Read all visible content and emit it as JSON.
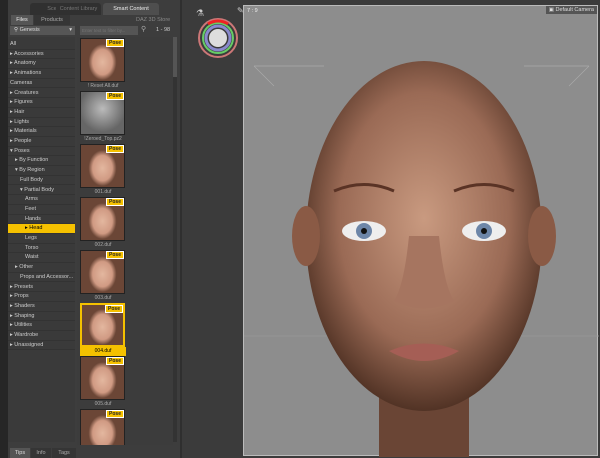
{
  "tabs": [
    "Scene",
    "Content Library",
    "Smart Content"
  ],
  "subtabs": [
    "Files",
    "Products"
  ],
  "store_label": "DAZ 3D Store",
  "figure_dropdown": "Genesis",
  "filter_placeholder": "Enter text to filter by...",
  "result_range": "1 - 98",
  "tree": [
    {
      "label": "All",
      "level": 0,
      "arrow": ""
    },
    {
      "label": "Accessories",
      "level": 0,
      "arrow": "▸"
    },
    {
      "label": "Anatomy",
      "level": 0,
      "arrow": "▸"
    },
    {
      "label": "Animations",
      "level": 0,
      "arrow": "▸"
    },
    {
      "label": "Cameras",
      "level": 0,
      "arrow": ""
    },
    {
      "label": "Creatures",
      "level": 0,
      "arrow": "▸"
    },
    {
      "label": "Figures",
      "level": 0,
      "arrow": "▸"
    },
    {
      "label": "Hair",
      "level": 0,
      "arrow": "▸"
    },
    {
      "label": "Lights",
      "level": 0,
      "arrow": "▸"
    },
    {
      "label": "Materials",
      "level": 0,
      "arrow": "▸"
    },
    {
      "label": "People",
      "level": 0,
      "arrow": "▸"
    },
    {
      "label": "Poses",
      "level": 0,
      "arrow": "▾"
    },
    {
      "label": "By Function",
      "level": 1,
      "arrow": "▸"
    },
    {
      "label": "By Region",
      "level": 1,
      "arrow": "▾"
    },
    {
      "label": "Full Body",
      "level": 2,
      "arrow": ""
    },
    {
      "label": "Partial Body",
      "level": 2,
      "arrow": "▾"
    },
    {
      "label": "Arms",
      "level": 3,
      "arrow": ""
    },
    {
      "label": "Feet",
      "level": 3,
      "arrow": ""
    },
    {
      "label": "Hands",
      "level": 3,
      "arrow": ""
    },
    {
      "label": "Head",
      "level": 3,
      "arrow": "▸",
      "selected": true
    },
    {
      "label": "Legs",
      "level": 3,
      "arrow": ""
    },
    {
      "label": "Torso",
      "level": 3,
      "arrow": ""
    },
    {
      "label": "Waist",
      "level": 3,
      "arrow": ""
    },
    {
      "label": "Other",
      "level": 1,
      "arrow": "▸"
    },
    {
      "label": "Props and Accessor...",
      "level": 2,
      "arrow": ""
    },
    {
      "label": "Presets",
      "level": 0,
      "arrow": "▸"
    },
    {
      "label": "Props",
      "level": 0,
      "arrow": "▸"
    },
    {
      "label": "Shaders",
      "level": 0,
      "arrow": "▸"
    },
    {
      "label": "Shaping",
      "level": 0,
      "arrow": "▸"
    },
    {
      "label": "Utilities",
      "level": 0,
      "arrow": "▸"
    },
    {
      "label": "Wardrobe",
      "level": 0,
      "arrow": "▸"
    },
    {
      "label": "Unassigned",
      "level": 0,
      "arrow": "▸"
    }
  ],
  "thumbs": [
    {
      "label": "! Reset All.duf",
      "badge": "Pose"
    },
    {
      "label": "!Zeroed_Top.pz2",
      "badge": "Pose",
      "mannequin": true
    },
    {
      "label": "001.duf",
      "badge": "Pose"
    },
    {
      "label": "002.duf",
      "badge": "Pose"
    },
    {
      "label": "003.duf",
      "badge": "Pose"
    },
    {
      "label": "004.duf",
      "badge": "Pose",
      "selected": true
    },
    {
      "label": "005.duf",
      "badge": "Pose"
    },
    {
      "label": "",
      "badge": "Pose"
    }
  ],
  "bottom_tabs": [
    "Tips",
    "Info",
    "Tags"
  ],
  "viewport": {
    "aspect": "7 : 9",
    "camera": "Default Camera"
  },
  "colors": {
    "accent": "#f5c100"
  }
}
